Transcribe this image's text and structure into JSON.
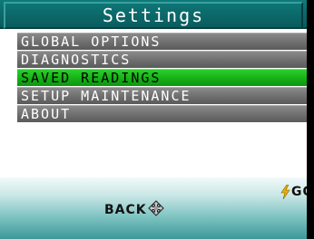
{
  "title": "Settings",
  "menu": {
    "items": [
      {
        "label": "GLOBAL OPTIONS"
      },
      {
        "label": "DIAGNOSTICS"
      },
      {
        "label": "SAVED READINGS"
      },
      {
        "label": "SETUP MAINTENANCE"
      },
      {
        "label": "ABOUT"
      }
    ],
    "selected_index": 2
  },
  "softkeys": {
    "go_label": "GO",
    "go_icon": "lightning-bolt-icon",
    "back_label": "BACK",
    "back_icon": "dpad-arrows-icon"
  },
  "colors": {
    "title_bar": "#0c6b6c",
    "menu_item": "#6e6e6e",
    "menu_selected": "#16b016",
    "bolt": "#e8b000"
  }
}
